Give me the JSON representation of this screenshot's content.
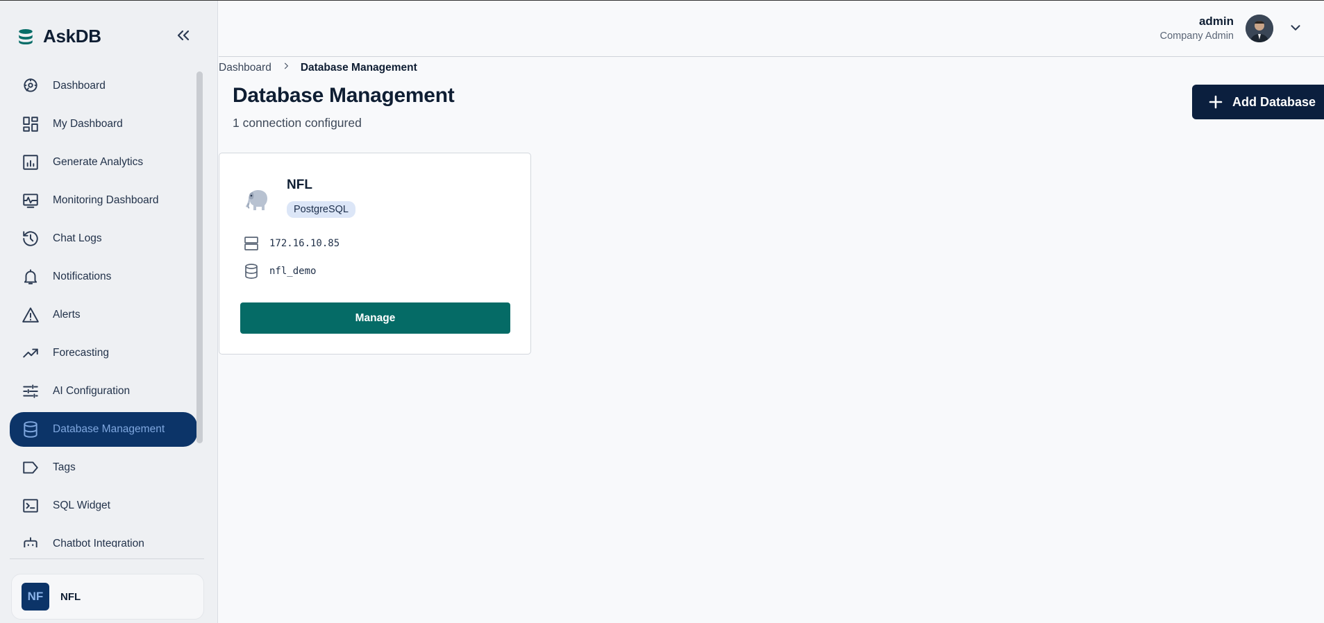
{
  "brand": {
    "name": "AskDB"
  },
  "sidebar": {
    "items": [
      {
        "label": "Dashboard",
        "icon": "dashboard-icon"
      },
      {
        "label": "My Dashboard",
        "icon": "grid-icon"
      },
      {
        "label": "Generate Analytics",
        "icon": "analytics-icon"
      },
      {
        "label": "Monitoring Dashboard",
        "icon": "monitor-icon"
      },
      {
        "label": "Chat Logs",
        "icon": "history-icon"
      },
      {
        "label": "Notifications",
        "icon": "bell-icon"
      },
      {
        "label": "Alerts",
        "icon": "alert-icon"
      },
      {
        "label": "Forecasting",
        "icon": "trend-icon"
      },
      {
        "label": "AI Configuration",
        "icon": "sliders-icon"
      },
      {
        "label": "Database Management",
        "icon": "database-icon",
        "active": true
      },
      {
        "label": "Tags",
        "icon": "tag-icon"
      },
      {
        "label": "SQL Widget",
        "icon": "terminal-icon"
      },
      {
        "label": "Chatbot Integration",
        "icon": "bot-icon"
      }
    ],
    "org": {
      "initials": "NF",
      "name": "NFL",
      "color": "#0c3468"
    }
  },
  "header": {
    "user_name": "admin",
    "user_role": "Company Admin"
  },
  "breadcrumb": {
    "parent": "Dashboard",
    "current": "Database Management"
  },
  "page": {
    "title": "Database Management",
    "subtitle": "1 connection configured",
    "add_label": "Add Database"
  },
  "connections": [
    {
      "name": "NFL",
      "type": "PostgreSQL",
      "host": "172.16.10.85",
      "database": "nfl_demo",
      "action_label": "Manage"
    }
  ],
  "colors": {
    "accent": "#0c3468",
    "manage_button": "#056b66",
    "add_button": "#0b1f3e",
    "badge_bg": "#dce6f7"
  }
}
